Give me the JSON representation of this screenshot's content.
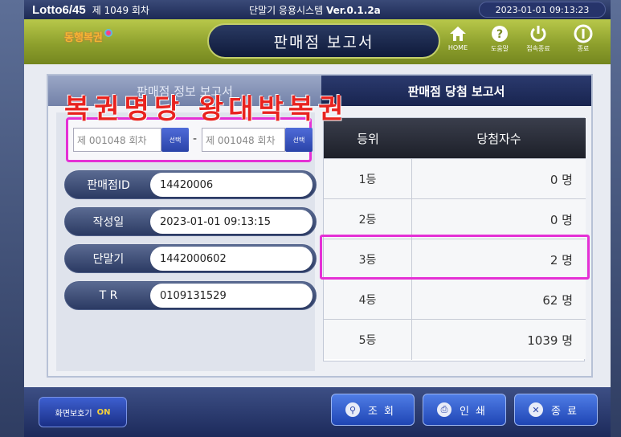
{
  "topbar": {
    "app": "Lotto6/45",
    "round": "제 1049 회차",
    "system": "단말기 응용시스템",
    "version": "Ver.0.1.2a",
    "datetime": "2023-01-01  09:13:23"
  },
  "header": {
    "logo": "동행복권",
    "title": "판매점 보고서",
    "buttons": [
      {
        "label": "HOME",
        "icon": "home-icon"
      },
      {
        "label": "도움말",
        "icon": "help-icon"
      },
      {
        "label": "접속종료",
        "icon": "power-icon"
      },
      {
        "label": "종료",
        "icon": "exit-icon"
      }
    ]
  },
  "tabs": {
    "info": "판매점 정보 보고서",
    "winning": "판매점 당첨 보고서"
  },
  "range": {
    "from": "제 001048 회차",
    "to": "제 001048 회차",
    "select": "선택",
    "dash": "-"
  },
  "info": {
    "rows": [
      {
        "label": "판매점ID",
        "value": "14420006"
      },
      {
        "label": "작성일",
        "value": "2023-01-01  09:13:15"
      },
      {
        "label": "단말기",
        "value": "1442000602"
      },
      {
        "label": "T R",
        "value": "0109131529"
      }
    ]
  },
  "watermark": "복권명당 왕대박복권",
  "table": {
    "headers": [
      "등위",
      "당첨자수"
    ],
    "rows": [
      {
        "rank": "1등",
        "count": "0 명"
      },
      {
        "rank": "2등",
        "count": "0 명"
      },
      {
        "rank": "3등",
        "count": "2 명"
      },
      {
        "rank": "4등",
        "count": "62 명"
      },
      {
        "rank": "5등",
        "count": "1039 명"
      }
    ]
  },
  "bottom": {
    "screensaver": "화면보호기",
    "screensaver_state": "ON",
    "lookup": "조회",
    "print": "인쇄",
    "close": "종료"
  },
  "colors": {
    "highlight": "#e530d5",
    "watermark": "#e8231f",
    "header_green": "#8ea02d",
    "navy": "#1d2a55"
  }
}
